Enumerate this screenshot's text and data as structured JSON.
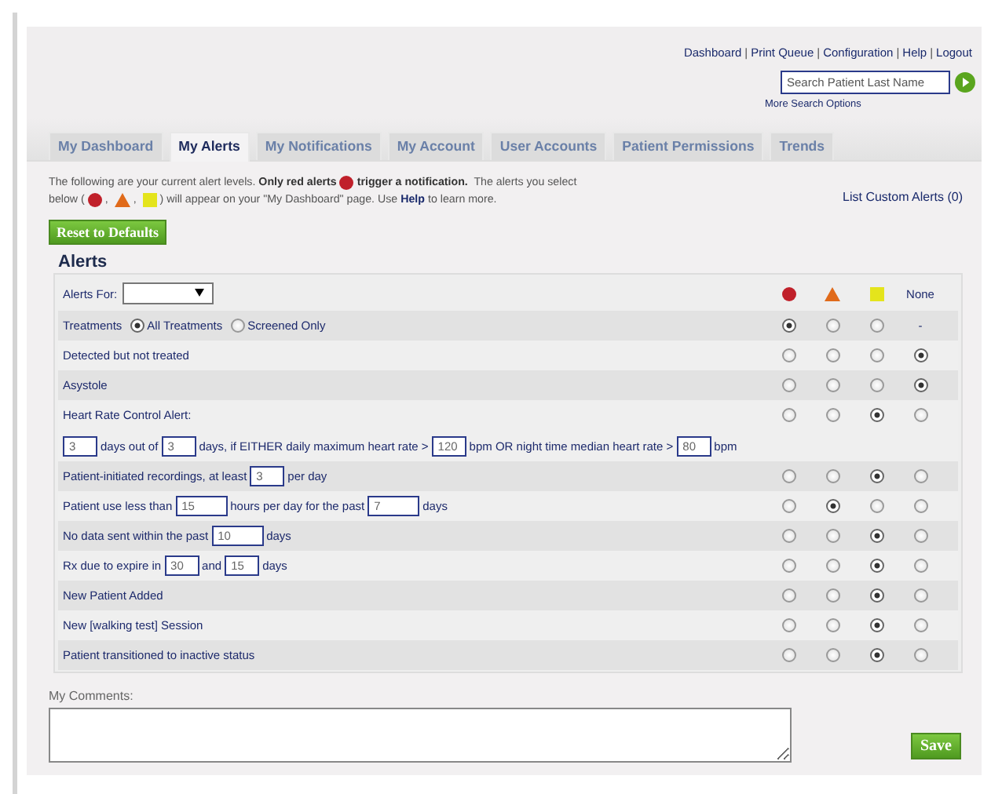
{
  "top_links": [
    {
      "label": "Dashboard"
    },
    {
      "sep": "|",
      "label": "Print Queue"
    },
    {
      "sep": "|",
      "label": "Configuration"
    },
    {
      "sep": "|",
      "label": "Help"
    },
    {
      "sep": "|",
      "label": "Logout"
    }
  ],
  "search": {
    "placeholder": "Search Patient Last Name",
    "more_link": "More Search Options"
  },
  "tabs": [
    {
      "label": "My Dashboard",
      "selected": false
    },
    {
      "label": "My Alerts",
      "selected": true
    },
    {
      "label": "My Notifications",
      "selected": false
    },
    {
      "label": "My Account",
      "selected": false
    },
    {
      "label": "User Accounts",
      "selected": false
    },
    {
      "label": "Patient Permissions",
      "selected": false
    },
    {
      "label": "Trends",
      "selected": false
    }
  ],
  "intro": [
    [
      {
        "kind": "text",
        "text": "The following are your current alert levels. **Only red alerts**"
      },
      {
        "kind": "circle",
        "color": "#c0202a"
      },
      {
        "kind": "text",
        "text": "**trigger a notification.**  The alerts you select"
      }
    ],
    [
      {
        "kind": "text",
        "text": "below ("
      },
      {
        "kind": "circle",
        "color": "#c0202a"
      },
      {
        "kind": "text",
        "text": ", "
      },
      {
        "kind": "triangle",
        "color": "#e06a1a"
      },
      {
        "kind": "text",
        "text": ", "
      },
      {
        "kind": "square",
        "color": "#e4e41c"
      },
      {
        "kind": "text",
        "text": ") will appear on your \"My Dashboard\" page. Use"
      },
      {
        "kind": "link",
        "text": "Help"
      },
      {
        "kind": "text",
        "text": "to learn more."
      }
    ]
  ],
  "custom_alerts_link": "List Custom Alerts (0)",
  "reset_button": "Reset to Defaults",
  "alerts": {
    "title": "Alerts",
    "alerts_for_label": "Alerts For:",
    "levels": [
      {
        "kind": "circle",
        "color": "#c0202a"
      },
      {
        "kind": "triangle",
        "color": "#e06a1a"
      },
      {
        "kind": "square",
        "color": "#e4e41c"
      },
      {
        "kind": "text",
        "text": "None"
      }
    ],
    "rows": [
      {
        "parts": [
          {
            "kind": "text",
            "text": "Treatments"
          },
          {
            "kind": "radio",
            "text": "All Treatments",
            "selected": true
          },
          {
            "kind": "radio",
            "text": "Screened Only",
            "selected": false
          }
        ],
        "choices": [
          {
            "kind": "radio",
            "selected": true
          },
          {
            "kind": "radio",
            "selected": false
          },
          {
            "kind": "radio",
            "selected": false
          },
          {
            "kind": "dash",
            "text": "-"
          }
        ]
      },
      {
        "parts": [
          {
            "kind": "text",
            "text": "Detected but not treated"
          }
        ],
        "choices": [
          {
            "kind": "radio",
            "selected": false
          },
          {
            "kind": "radio",
            "selected": false
          },
          {
            "kind": "radio",
            "selected": false
          },
          {
            "kind": "radio",
            "selected": true
          }
        ]
      },
      {
        "parts": [
          {
            "kind": "text",
            "text": "Asystole"
          }
        ],
        "choices": [
          {
            "kind": "radio",
            "selected": false
          },
          {
            "kind": "radio",
            "selected": false
          },
          {
            "kind": "radio",
            "selected": false
          },
          {
            "kind": "radio",
            "selected": true
          }
        ]
      },
      {
        "parts": [
          {
            "kind": "text",
            "text": "Heart Rate Control Alert:"
          }
        ],
        "detail": [
          {
            "kind": "input",
            "value": "3"
          },
          {
            "kind": "text",
            "text": "days out of"
          },
          {
            "kind": "input",
            "value": "3"
          },
          {
            "kind": "text",
            "text": "days, if EITHER daily maximum heart rate >"
          },
          {
            "kind": "input",
            "value": "120"
          },
          {
            "kind": "text",
            "text": "bpm OR night time median heart rate >"
          },
          {
            "kind": "input",
            "value": "80"
          },
          {
            "kind": "text",
            "text": "bpm"
          }
        ],
        "choices": [
          {
            "kind": "radio",
            "selected": false
          },
          {
            "kind": "radio",
            "selected": false
          },
          {
            "kind": "radio",
            "selected": true
          },
          {
            "kind": "radio",
            "selected": false
          }
        ]
      },
      {
        "parts": [
          {
            "kind": "text",
            "text": "Patient-initiated recordings, at least"
          },
          {
            "kind": "input",
            "value": "3"
          },
          {
            "kind": "text",
            "text": "per day"
          }
        ],
        "choices": [
          {
            "kind": "radio",
            "selected": false
          },
          {
            "kind": "radio",
            "selected": false
          },
          {
            "kind": "radio",
            "selected": true
          },
          {
            "kind": "radio",
            "selected": false
          }
        ]
      },
      {
        "parts": [
          {
            "kind": "text",
            "text": "Patient use less than"
          },
          {
            "kind": "input",
            "value": "15",
            "wide": true
          },
          {
            "kind": "text",
            "text": "hours per day for the past"
          },
          {
            "kind": "input",
            "value": "7",
            "wide": true
          },
          {
            "kind": "text",
            "text": "days"
          }
        ],
        "choices": [
          {
            "kind": "radio",
            "selected": false
          },
          {
            "kind": "radio",
            "selected": true
          },
          {
            "kind": "radio",
            "selected": false
          },
          {
            "kind": "radio",
            "selected": false
          }
        ]
      },
      {
        "parts": [
          {
            "kind": "text",
            "text": "No data sent within the past"
          },
          {
            "kind": "input",
            "value": "10",
            "wide": true
          },
          {
            "kind": "text",
            "text": "days"
          }
        ],
        "choices": [
          {
            "kind": "radio",
            "selected": false
          },
          {
            "kind": "radio",
            "selected": false
          },
          {
            "kind": "radio",
            "selected": true
          },
          {
            "kind": "radio",
            "selected": false
          }
        ]
      },
      {
        "parts": [
          {
            "kind": "text",
            "text": "Rx due to expire in"
          },
          {
            "kind": "input",
            "value": "30"
          },
          {
            "kind": "text",
            "text": "and"
          },
          {
            "kind": "input",
            "value": "15"
          },
          {
            "kind": "text",
            "text": "days"
          }
        ],
        "choices": [
          {
            "kind": "radio",
            "selected": false
          },
          {
            "kind": "radio",
            "selected": false
          },
          {
            "kind": "radio",
            "selected": true
          },
          {
            "kind": "radio",
            "selected": false
          }
        ]
      },
      {
        "parts": [
          {
            "kind": "text",
            "text": "New Patient Added"
          }
        ],
        "choices": [
          {
            "kind": "radio",
            "selected": false
          },
          {
            "kind": "radio",
            "selected": false
          },
          {
            "kind": "radio",
            "selected": true
          },
          {
            "kind": "radio",
            "selected": false
          }
        ]
      },
      {
        "parts": [
          {
            "kind": "text",
            "text": "New [walking test] Session"
          }
        ],
        "choices": [
          {
            "kind": "radio",
            "selected": false
          },
          {
            "kind": "radio",
            "selected": false
          },
          {
            "kind": "radio",
            "selected": true
          },
          {
            "kind": "radio",
            "selected": false
          }
        ]
      },
      {
        "parts": [
          {
            "kind": "text",
            "text": "Patient transitioned to inactive status"
          }
        ],
        "choices": [
          {
            "kind": "radio",
            "selected": false
          },
          {
            "kind": "radio",
            "selected": false
          },
          {
            "kind": "radio",
            "selected": true
          },
          {
            "kind": "radio",
            "selected": false
          }
        ]
      }
    ]
  },
  "comments": {
    "label": "My Comments:"
  },
  "save_button": "Save"
}
